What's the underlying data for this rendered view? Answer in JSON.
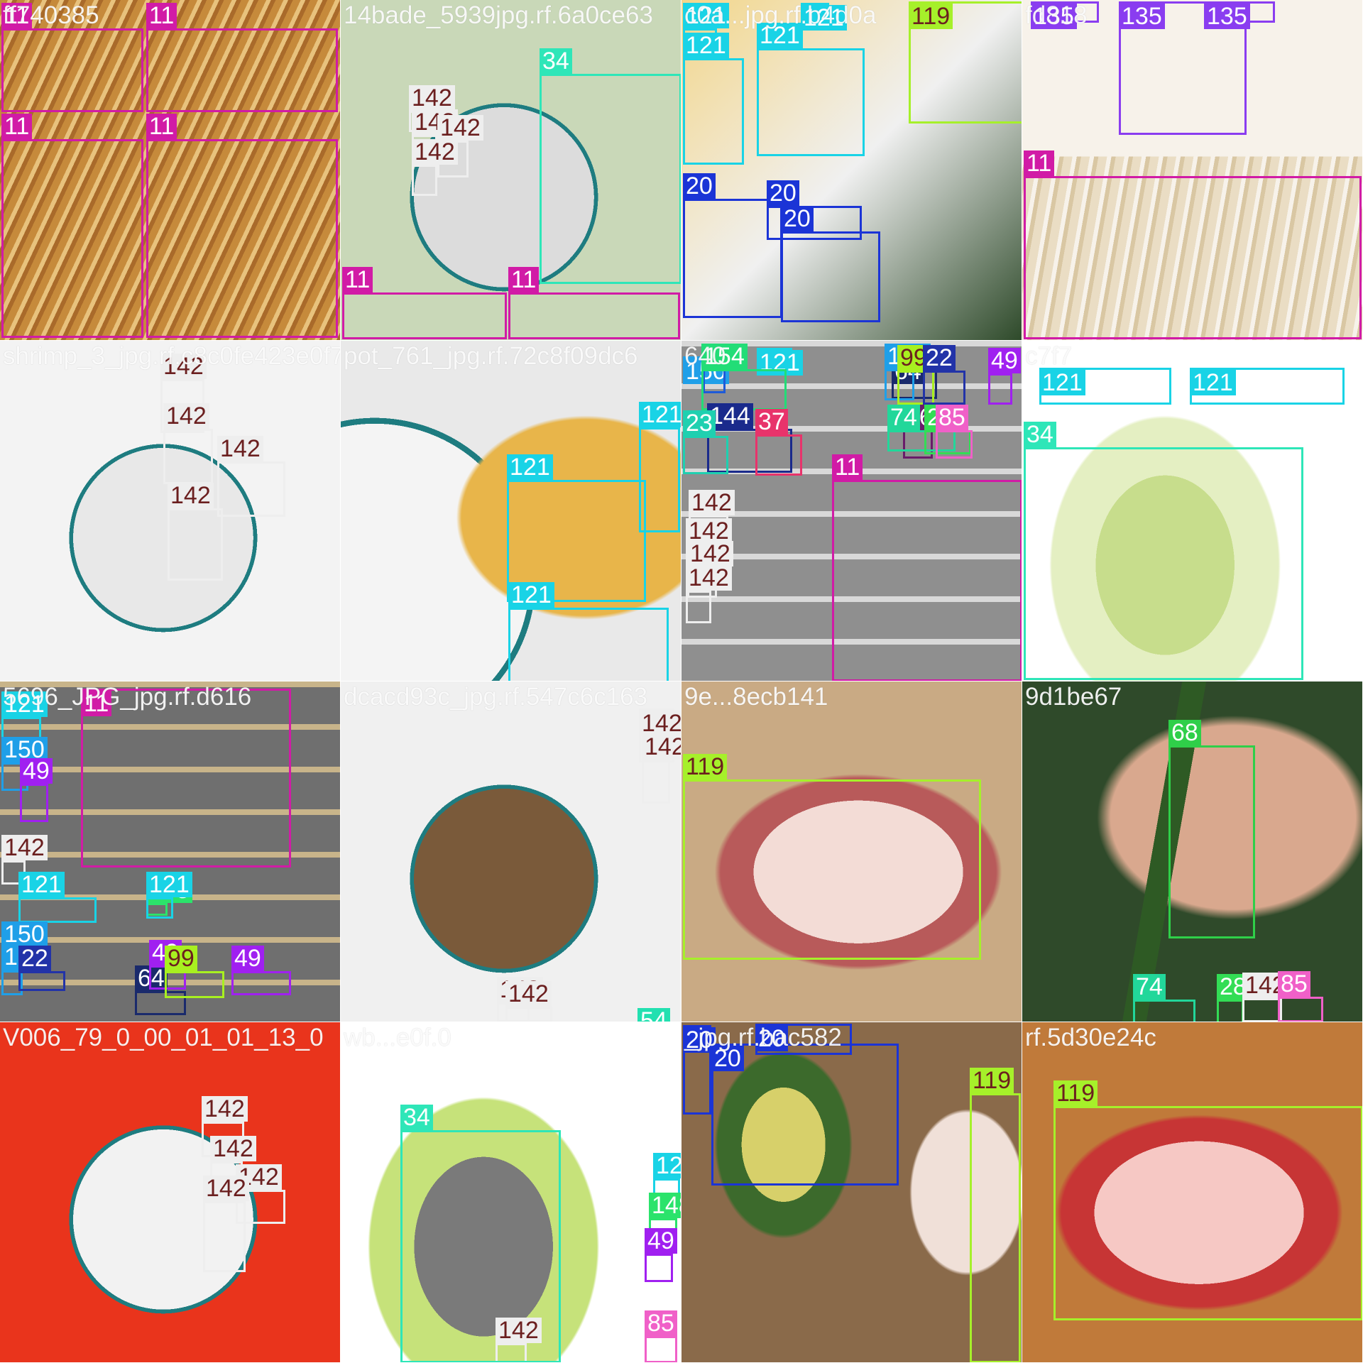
{
  "image": {
    "kind": "object detection training batch mosaic",
    "grid": {
      "columns": 4,
      "rows": 4
    }
  },
  "class_colors": {
    "11": "#d11ba6",
    "20": "#1b34d6",
    "22": "#2233a8",
    "23": "#1fd0b0",
    "28": "#33dd55",
    "34": "#2ee6b8",
    "37": "#e8336b",
    "49": "#a020f0",
    "54": "#22e0b0",
    "60": "#1d5ad8",
    "64": "#1a2a6c",
    "68": "#2fcf49",
    "74": "#22d79a",
    "76": "#6a1b6a",
    "85": "#f060c8",
    "99": "#a8f020",
    "119": "#a6f02a",
    "121": "#19d3e6",
    "135": "#8a3df0",
    "142": "#eeeeee",
    "144": "#1a2a8c",
    "148": "#2be36b",
    "150": "#1f9fe8",
    "154": "#22dd77"
  },
  "tiles": [
    {
      "caption": "ff740385",
      "scene": "golden mushroom gills",
      "palette": [
        "#c68a3b",
        "#e8c27d",
        "#a96a2a"
      ],
      "labels": [
        {
          "cls": "11",
          "text": "11"
        },
        {
          "cls": "11",
          "text": "11"
        },
        {
          "cls": "11",
          "text": "11"
        },
        {
          "cls": "11",
          "text": "11"
        }
      ]
    },
    {
      "caption": "14bade_5939jpg.rf.6a0ce63",
      "scene": "diced vegetables bowl and napa cabbage",
      "palette": [
        "#dcdcdc",
        "#c9d8b8",
        "#f2f2f2"
      ],
      "labels": [
        {
          "cls": "34",
          "text": "34"
        },
        {
          "cls": "142",
          "text": "142"
        },
        {
          "cls": "142",
          "text": "142"
        },
        {
          "cls": "142",
          "text": "142"
        },
        {
          "cls": "142",
          "text": "142"
        },
        {
          "cls": "11",
          "text": "11"
        },
        {
          "cls": "11",
          "text": "11"
        }
      ]
    },
    {
      "caption": "c0a...jpg.rf.b4d0a",
      "scene": "potatoes, pork belly and avocado",
      "palette": [
        "#f3d68a",
        "#f0f0f0",
        "#2e4a2a"
      ],
      "labels": [
        {
          "cls": "121",
          "text": "121"
        },
        {
          "cls": "121",
          "text": "121"
        },
        {
          "cls": "121",
          "text": "121"
        },
        {
          "cls": "121",
          "text": "121"
        },
        {
          "cls": "119",
          "text": "119"
        },
        {
          "cls": "20",
          "text": "20"
        },
        {
          "cls": "20",
          "text": "20"
        },
        {
          "cls": "20",
          "text": "20"
        }
      ]
    },
    {
      "caption": "fd818",
      "scene": "salmon fillet and white mushroom gills",
      "palette": [
        "#eaddc4",
        "#f7f2ea",
        "#d9c7a3"
      ],
      "labels": [
        {
          "cls": "135",
          "text": "135"
        },
        {
          "cls": "135",
          "text": "135"
        },
        {
          "cls": "135",
          "text": "135"
        },
        {
          "cls": "11",
          "text": "11"
        }
      ]
    },
    {
      "caption": "shrimp_3_jpg.rf.c8c0fe423e0f72",
      "scene": "shrimp and diced vegetables bowl",
      "palette": [
        "#e8e8e8",
        "#f3f3f3",
        "#c9a08a"
      ],
      "labels": [
        {
          "cls": "142",
          "text": "142"
        },
        {
          "cls": "142",
          "text": "142"
        },
        {
          "cls": "142",
          "text": "142"
        },
        {
          "cls": "142",
          "text": "142"
        }
      ]
    },
    {
      "caption": "pot_761_jpg.rf.72c8f09dc6",
      "scene": "sliced potatoes",
      "palette": [
        "#e9e9e9",
        "#f4f4f4",
        "#e8b54a"
      ],
      "labels": [
        {
          "cls": "121",
          "text": "121"
        },
        {
          "cls": "121",
          "text": "121"
        },
        {
          "cls": "121",
          "text": "121"
        }
      ]
    },
    {
      "caption": "640",
      "scene": "fridge shelves, bowl and mushroom gills",
      "palette": [
        "#8f8f8f",
        "#d8d8d8",
        "#bfb7a8"
      ],
      "labels": [
        {
          "cls": "150",
          "text": "150"
        },
        {
          "cls": "121",
          "text": "121"
        },
        {
          "cls": "60",
          "text": "60"
        },
        {
          "cls": "154",
          "text": "154"
        },
        {
          "cls": "144",
          "text": "144"
        },
        {
          "cls": "37",
          "text": "37"
        },
        {
          "cls": "23",
          "text": "23"
        },
        {
          "cls": "64",
          "text": "64"
        },
        {
          "cls": "150",
          "text": "150"
        },
        {
          "cls": "99",
          "text": "99"
        },
        {
          "cls": "22",
          "text": "22"
        },
        {
          "cls": "49",
          "text": "49"
        },
        {
          "cls": "76",
          "text": "76"
        },
        {
          "cls": "74",
          "text": "74"
        },
        {
          "cls": "28",
          "text": "28"
        },
        {
          "cls": "85",
          "text": "85"
        },
        {
          "cls": "142",
          "text": "142"
        },
        {
          "cls": "142",
          "text": "142"
        },
        {
          "cls": "142",
          "text": "142"
        },
        {
          "cls": "142",
          "text": "142"
        },
        {
          "cls": "11",
          "text": "11"
        }
      ]
    },
    {
      "caption": "c7f7",
      "scene": "napa cabbage on white",
      "palette": [
        "#ffffff",
        "#e4efc2",
        "#c7dd8c"
      ],
      "labels": [
        {
          "cls": "121",
          "text": "121"
        },
        {
          "cls": "121",
          "text": "121"
        },
        {
          "cls": "34",
          "text": "34"
        }
      ]
    },
    {
      "caption": "5696_JPG_jpg.rf.d616",
      "scene": "fridge interior and golden mushroom",
      "palette": [
        "#6f6f6f",
        "#c8b48a",
        "#d28c39"
      ],
      "labels": [
        {
          "cls": "11",
          "text": "11"
        },
        {
          "cls": "121",
          "text": "121"
        },
        {
          "cls": "150",
          "text": "150"
        },
        {
          "cls": "49",
          "text": "49"
        },
        {
          "cls": "142",
          "text": "142"
        },
        {
          "cls": "148",
          "text": "148"
        },
        {
          "cls": "121",
          "text": "121"
        },
        {
          "cls": "121",
          "text": "121"
        },
        {
          "cls": "150",
          "text": "150"
        },
        {
          "cls": "64",
          "text": "64"
        },
        {
          "cls": "150",
          "text": "150"
        },
        {
          "cls": "49",
          "text": "49"
        },
        {
          "cls": "99",
          "text": "99"
        },
        {
          "cls": "22",
          "text": "22"
        },
        {
          "cls": "49",
          "text": "49"
        }
      ]
    },
    {
      "caption": "dcacd93c_jpg.rf.547c6c163",
      "scene": "wooden board and bowl of diced daikon",
      "palette": [
        "#7a5a3a",
        "#f0f0f0",
        "#e3e3e3"
      ],
      "labels": [
        {
          "cls": "142",
          "text": "142"
        },
        {
          "cls": "142",
          "text": "142"
        },
        {
          "cls": "142",
          "text": "142"
        },
        {
          "cls": "142",
          "text": "142"
        },
        {
          "cls": "54",
          "text": "54"
        }
      ]
    },
    {
      "caption": "9e...8ecb141",
      "scene": "pork belly on paper",
      "palette": [
        "#c9aa84",
        "#f3dcd6",
        "#b85a5a"
      ],
      "labels": [
        {
          "cls": "119",
          "text": "119"
        }
      ]
    },
    {
      "caption": "9d1be67",
      "scene": "green chili pepper in hand",
      "palette": [
        "#2f4a2a",
        "#d9a88e",
        "#2e5a24"
      ],
      "labels": [
        {
          "cls": "68",
          "text": "68"
        },
        {
          "cls": "74",
          "text": "74"
        },
        {
          "cls": "28",
          "text": "28"
        },
        {
          "cls": "142",
          "text": "142"
        },
        {
          "cls": "85",
          "text": "85"
        }
      ]
    },
    {
      "caption": "V006_79_0_00_01_01_13_0",
      "scene": "bowl of red pepper and daikon",
      "palette": [
        "#f2f2f2",
        "#e9341c",
        "#ffffff"
      ],
      "labels": [
        {
          "cls": "142",
          "text": "142"
        },
        {
          "cls": "142",
          "text": "142"
        },
        {
          "cls": "142",
          "text": "142"
        },
        {
          "cls": "142",
          "text": "142"
        }
      ]
    },
    {
      "caption": "wb...e0f.0",
      "scene": "napa cabbage and fridge",
      "palette": [
        "#ffffff",
        "#c6e27a",
        "#7a7a7a"
      ],
      "labels": [
        {
          "cls": "142",
          "text": "142"
        },
        {
          "cls": "34",
          "text": "34"
        },
        {
          "cls": "121",
          "text": "121"
        },
        {
          "cls": "148",
          "text": "148"
        },
        {
          "cls": "49",
          "text": "49"
        },
        {
          "cls": "85",
          "text": "85"
        }
      ]
    },
    {
      "caption": "_jpg.rf.bac582",
      "scene": "avocado halves and pork",
      "palette": [
        "#2d3a2a",
        "#8a6a4a",
        "#f0e0d8"
      ],
      "labels": [
        {
          "cls": "20",
          "text": "20"
        },
        {
          "cls": "20",
          "text": "20"
        },
        {
          "cls": "20",
          "text": "20"
        },
        {
          "cls": "119",
          "text": "119"
        }
      ]
    },
    {
      "caption": "rf.5d30e24c",
      "scene": "pork belly on brown paper",
      "palette": [
        "#c07a3a",
        "#f6c8c4",
        "#c73535"
      ],
      "labels": [
        {
          "cls": "119",
          "text": "119"
        }
      ]
    }
  ]
}
